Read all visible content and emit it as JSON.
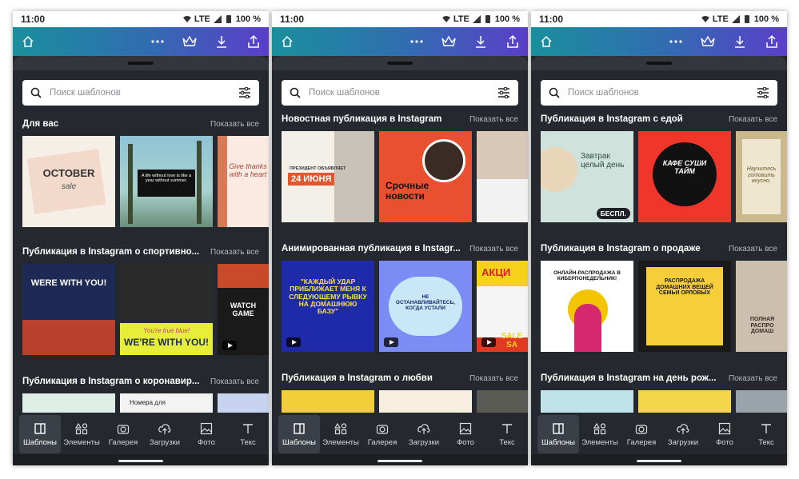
{
  "status": {
    "time": "11:00",
    "network": "LTE",
    "battery": "100 %"
  },
  "search": {
    "placeholder": "Поиск шаблонов"
  },
  "show_all": "Показать все",
  "nav": [
    "Шаблоны",
    "Элементы",
    "Галерея",
    "Загрузки",
    "Фото",
    "Текс"
  ],
  "screens": [
    {
      "sections": [
        {
          "title": "Для вас"
        },
        {
          "title": "Публикация в Instagram о спортивно..."
        },
        {
          "title": "Публикация в Instagram о коронавир..."
        }
      ],
      "thumbs": {
        "s1": [
          "OCTOBER",
          "sale",
          "A life without love is like a year without summer.",
          "Give thanks with a heart"
        ],
        "s2": [
          "WERE WITH YOU!",
          "You're true blue!",
          "WE'RE WITH YOU!",
          "WATCH GAME"
        ],
        "s3": [
          "Номера для"
        ]
      }
    },
    {
      "sections": [
        {
          "title": "Новостная публикация в Instagram"
        },
        {
          "title": "Анимированная публикация в Instagr..."
        },
        {
          "title": "Публикация в Instagram о любви"
        }
      ],
      "thumbs": {
        "s1": [
          "ПРЕЗИДЕНТ ОБЪЯВЛЯЕТ",
          "24 ИЮНЯ",
          "Срочные новости"
        ],
        "s2": [
          "\"КАЖДЫЙ УДАР ПРИБЛИЖАЕТ МЕНЯ К СЛЕДУЮЩЕМУ РЫВКУ НА ДОМАШНЮЮ БАЗУ\"",
          "НЕ ОСТАНАВЛИВАЙТЕСЬ, КОГДА УСТАЛИ",
          "АКЦИ",
          "SALE SA"
        ]
      }
    },
    {
      "sections": [
        {
          "title": "Публикация в Instagram с едой"
        },
        {
          "title": "Публикация в Instagram о продаже"
        },
        {
          "title": "Публикация в Instagram на день рож..."
        }
      ],
      "thumbs": {
        "s1": [
          "Завтрак целый день",
          "БЕСПЛ.",
          "КАФЕ СУШИ ТАЙМ",
          "Научитесь готовить вкусно."
        ],
        "s2": [
          "ОНЛАЙН-РАСПРОДАЖА В КИБЕРПОНЕДЕЛЬНИК!",
          "РАСПРОДАЖА ДОМАШНИХ ВЕЩЕЙ СЕМЬИ ОРЛОВЫХ",
          "ПОЛНАЯ РАСПРО ДОМАШ"
        ]
      }
    }
  ]
}
